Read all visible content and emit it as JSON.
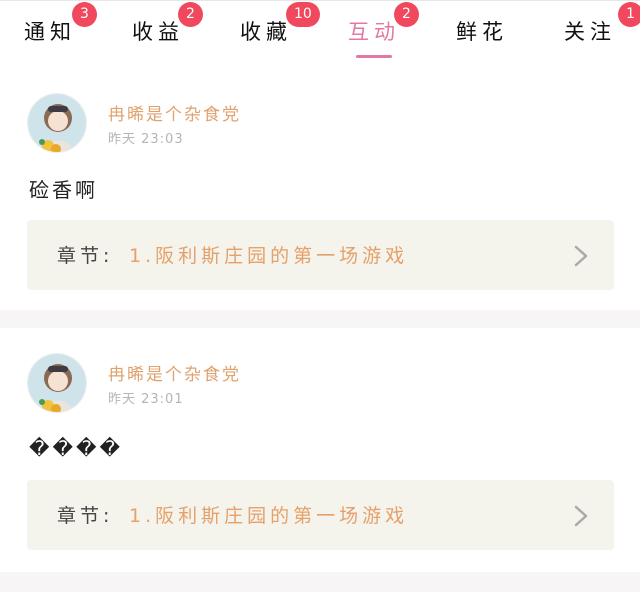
{
  "tabs": [
    {
      "label": "通知",
      "badge": "3"
    },
    {
      "label": "收益",
      "badge": "2"
    },
    {
      "label": "收藏",
      "badge": "10"
    },
    {
      "label": "互动",
      "badge": "2",
      "active": true
    },
    {
      "label": "鲜花",
      "badge": ""
    },
    {
      "label": "关注",
      "badge": "1"
    }
  ],
  "comments": [
    {
      "username": "冉晞是个杂食党",
      "timestamp": "昨天 23:03",
      "text": "硷香啊",
      "chapter_prefix": "章节:",
      "chapter_title": "1.阪利斯庄园的第一场游戏"
    },
    {
      "username": "冉晞是个杂食党",
      "timestamp": "昨天 23:01",
      "text": "����",
      "chapter_prefix": "章节:",
      "chapter_title": "1.阪利斯庄园的第一场游戏"
    }
  ],
  "colors": {
    "accent": "#e07aa5",
    "badge": "#f0485c",
    "username": "#e0a26e",
    "chapter_title": "#e6a06a",
    "chapter_box": "#f4f4ec"
  },
  "icons": {
    "avatar": "anime-girl-avatar-icon",
    "chevron": "chevron-right-icon"
  }
}
